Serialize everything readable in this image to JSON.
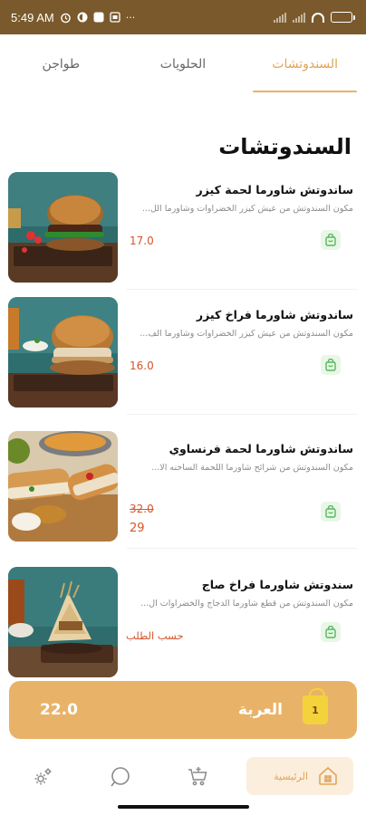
{
  "status_bar": {
    "time": "5:49 AM",
    "icons": [
      "alarm-icon",
      "app-icon",
      "app-icon",
      "sim-icon",
      "more-icon",
      "signal-icon",
      "signal-icon",
      "wifi-icon",
      "battery-icon"
    ],
    "more_glyph": "···",
    "battery_fill_fraction": 0.8,
    "battery_color": "#9be35a"
  },
  "tabs": [
    {
      "label": "السندوتشات",
      "active": true
    },
    {
      "label": "الحلويات",
      "active": false
    },
    {
      "label": "طواجن",
      "active": false
    }
  ],
  "section_title": "السندوتشات",
  "items": [
    {
      "name": "ساندوتش شاورما لحمة كيزر",
      "description": "مكون السندوتش من عيش كيزر الخضراوات وشاورما الل...",
      "price": "17.0"
    },
    {
      "name": "ساندوتش شاورما فراخ كيزر",
      "description": "مكون السندوتش من عيش كيزر الخضراوات وشاورما الف...",
      "price": "16.0"
    },
    {
      "name": "ساندوتش شاورما لحمة فرنساوي",
      "description": "مكون السندوتش من شرائح شاورما اللحمة الساخنه الا...",
      "old_price": "32.0",
      "new_price": "29"
    },
    {
      "name": "سندوتش شاورما فراخ صاج",
      "description": "مكون السندوتش من قطع شاورما الدجاج والخضراوات ال...",
      "on_request": "حسب الطلب"
    }
  ],
  "cart": {
    "label": "العربة",
    "total": "22.0",
    "count": "1"
  },
  "bottom_nav": {
    "home_label": "الرئيسية",
    "items": [
      "settings-icon",
      "search-icon",
      "cart-icon",
      "home-icon"
    ]
  },
  "colors": {
    "accent": "#e8b368",
    "price": "#d6542b",
    "status_bar": "#7a5a2c",
    "cart_button_bg": "#e8f7e6",
    "cart_icon": "#56b85f"
  }
}
